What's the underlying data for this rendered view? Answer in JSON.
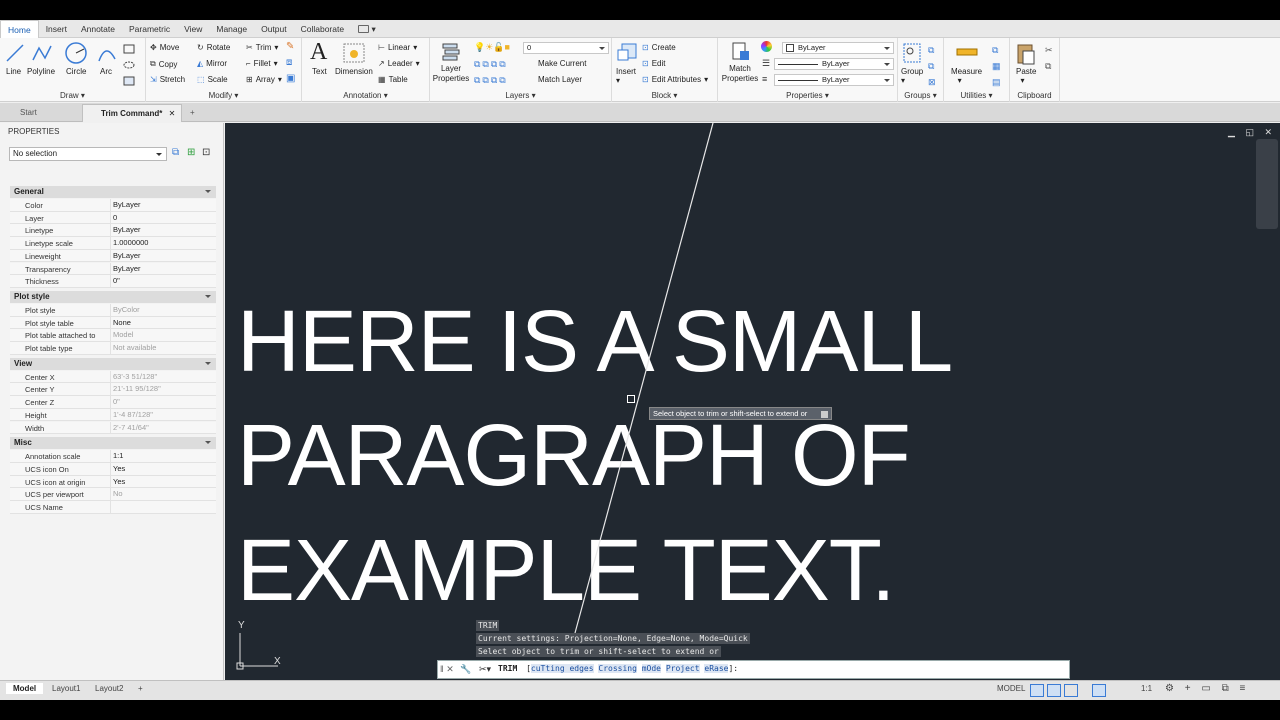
{
  "ribbon_tabs": [
    "Home",
    "Insert",
    "Annotate",
    "Parametric",
    "View",
    "Manage",
    "Output",
    "Collaborate"
  ],
  "draw": {
    "title": "Draw",
    "line": "Line",
    "polyline": "Polyline",
    "circle": "Circle",
    "arc": "Arc"
  },
  "modify": {
    "title": "Modify",
    "move": "Move",
    "rotate": "Rotate",
    "trim": "Trim",
    "copy": "Copy",
    "mirror": "Mirror",
    "fillet": "Fillet",
    "stretch": "Stretch",
    "scale": "Scale",
    "array": "Array"
  },
  "annotation": {
    "title": "Annotation",
    "text": "Text",
    "dimension": "Dimension",
    "linear": "Linear",
    "leader": "Leader",
    "table": "Table"
  },
  "layers": {
    "title": "Layers",
    "layer_properties_1": "Layer",
    "layer_properties_2": "Properties",
    "current_layer": "0",
    "make_current": "Make Current",
    "match_layer": "Match Layer"
  },
  "block": {
    "title": "Block",
    "insert": "Insert",
    "create": "Create",
    "edit": "Edit",
    "edit_attributes": "Edit Attributes"
  },
  "properties_panel": {
    "title": "Properties",
    "match_1": "Match",
    "match_2": "Properties",
    "color": "ByLayer",
    "linetype": "ByLayer",
    "lineweight": "ByLayer"
  },
  "groups": {
    "title": "Groups",
    "group": "Group"
  },
  "utilities": {
    "title": "Utilities",
    "measure": "Measure"
  },
  "clipboard": {
    "title": "Clipboard",
    "paste": "Paste"
  },
  "doc_tabs": {
    "start": "Start",
    "active": "Trim Command*",
    "plus": "+"
  },
  "props": {
    "header": "PROPERTIES",
    "selection": "No selection",
    "general": {
      "title": "General",
      "rows": [
        [
          "Color",
          "ByLayer"
        ],
        [
          "Layer",
          "0"
        ],
        [
          "Linetype",
          "ByLayer"
        ],
        [
          "Linetype scale",
          "1.0000000"
        ],
        [
          "Lineweight",
          "ByLayer"
        ],
        [
          "Transparency",
          "ByLayer"
        ],
        [
          "Thickness",
          "0\""
        ]
      ]
    },
    "plot": {
      "title": "Plot style",
      "rows": [
        [
          "Plot style",
          "ByColor"
        ],
        [
          "Plot style table",
          "None"
        ],
        [
          "Plot table attached to",
          "Model"
        ],
        [
          "Plot table type",
          "Not available"
        ]
      ]
    },
    "view": {
      "title": "View",
      "rows": [
        [
          "Center X",
          "63'-3 51/128\""
        ],
        [
          "Center Y",
          "21'-11 95/128\""
        ],
        [
          "Center Z",
          "0\""
        ],
        [
          "Height",
          "1'-4 87/128\""
        ],
        [
          "Width",
          "2'-7 41/64\""
        ]
      ]
    },
    "misc": {
      "title": "Misc",
      "rows": [
        [
          "Annotation scale",
          "1:1"
        ],
        [
          "UCS icon On",
          "Yes"
        ],
        [
          "UCS icon at origin",
          "Yes"
        ],
        [
          "UCS per viewport",
          "No"
        ],
        [
          "UCS Name",
          ""
        ]
      ]
    }
  },
  "canvas": {
    "line1": "HERE IS A SMALL",
    "line2": "PARAGRAPH OF",
    "line3": "EXAMPLE TEXT.",
    "tooltip": "Select object to trim or shift-select to extend or",
    "cmd_history": [
      "TRIM",
      "Current settings: Projection=None, Edge=None, Mode=Quick",
      "Select object to trim or shift-select to extend or"
    ],
    "prompt_cmd": "TRIM",
    "prompt_open": "[",
    "prompt_options": [
      "cuTting edges",
      "Crossing",
      "mOde",
      "Project",
      "eRase"
    ],
    "prompt_close": "]:",
    "axis_x": "X",
    "axis_y": "Y"
  },
  "status": {
    "model_tab": "Model",
    "layout1": "Layout1",
    "layout2": "Layout2",
    "plus": "+",
    "model_btn": "MODEL",
    "scale": "1:1"
  }
}
